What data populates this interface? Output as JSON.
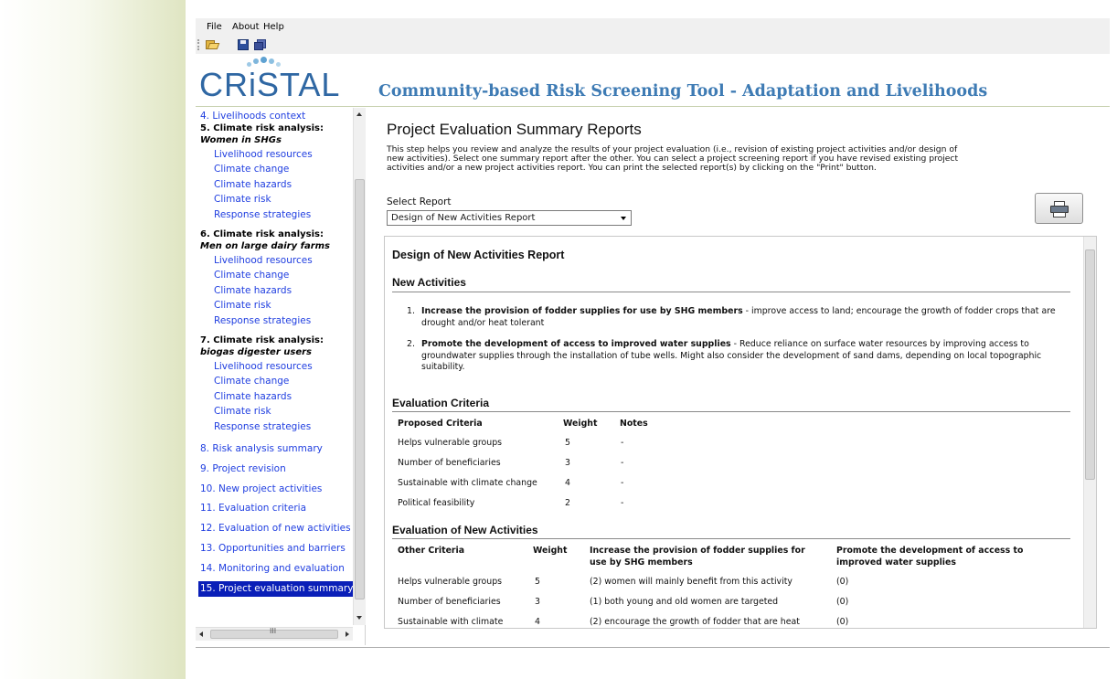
{
  "menu": {
    "items": [
      "File",
      "About",
      "Help"
    ]
  },
  "toolbar": {
    "open_icon": "open-folder-icon",
    "save_icon": "save-icon",
    "save_all_icon": "save-all-icon"
  },
  "logo": {
    "text": "CRiSTAL"
  },
  "app_title": "Community-based Risk Screening Tool - Adaptation and Livelihoods",
  "colors": {
    "nav_link": "#1f3ee0",
    "nav_active_bg": "#0a1fb8",
    "title": "#3e7bb4",
    "logo": "#2f67a3"
  },
  "sidebar": {
    "items": [
      {
        "kind": "link",
        "label": "4. Livelihoods context"
      },
      {
        "kind": "heading",
        "label": "5. Climate risk analysis:",
        "sub": "Women in SHGs"
      },
      {
        "kind": "sub",
        "label": "Livelihood resources"
      },
      {
        "kind": "sub",
        "label": "Climate change"
      },
      {
        "kind": "sub",
        "label": "Climate hazards"
      },
      {
        "kind": "sub",
        "label": "Climate risk"
      },
      {
        "kind": "sub",
        "label": "Response strategies"
      },
      {
        "kind": "heading",
        "label": "6. Climate risk analysis:",
        "sub": "Men on large dairy farms"
      },
      {
        "kind": "sub",
        "label": "Livelihood resources"
      },
      {
        "kind": "sub",
        "label": "Climate change"
      },
      {
        "kind": "sub",
        "label": "Climate hazards"
      },
      {
        "kind": "sub",
        "label": "Climate risk"
      },
      {
        "kind": "sub",
        "label": "Response strategies"
      },
      {
        "kind": "heading",
        "label": "7. Climate risk analysis:",
        "sub": "biogas digester users"
      },
      {
        "kind": "sub",
        "label": "Livelihood resources"
      },
      {
        "kind": "sub",
        "label": "Climate change"
      },
      {
        "kind": "sub",
        "label": "Climate hazards"
      },
      {
        "kind": "sub",
        "label": "Climate risk"
      },
      {
        "kind": "sub",
        "label": "Response strategies"
      },
      {
        "kind": "link",
        "label": "8. Risk analysis summary"
      },
      {
        "kind": "link",
        "label": "9. Project revision"
      },
      {
        "kind": "link",
        "label": "10. New project activities"
      },
      {
        "kind": "link",
        "label": "11. Evaluation criteria"
      },
      {
        "kind": "link",
        "label": "12. Evaluation of new activities"
      },
      {
        "kind": "link",
        "label": "13. Opportunities and barriers"
      },
      {
        "kind": "link",
        "label": "14. Monitoring and evaluation"
      },
      {
        "kind": "active",
        "label": "15. Project evaluation summary"
      }
    ],
    "hscroll_glyph": "III"
  },
  "main": {
    "title": "Project Evaluation Summary Reports",
    "intro": "This step helps you review and analyze the results of your project evaluation (i.e., revision of existing project activities and/or design of new activities). Select one summary report after the other. You can select a project screening report if you have revised existing project activities and/or a new project activities report. You can print the selected report(s) by clicking on the \"Print\" button.",
    "select_label": "Select Report",
    "select_value": "Design of New Activities Report",
    "print_icon": "printer-icon"
  },
  "report": {
    "title": "Design of New Activities Report",
    "new_activities": {
      "heading": "New Activities",
      "items": [
        {
          "num": "1.",
          "bold": "Increase the provision of fodder supplies for use by SHG members",
          "text": " - improve access to land; encourage the growth of fodder crops that are drought and/or heat tolerant"
        },
        {
          "num": "2.",
          "bold": "Promote the development of access to improved water supplies",
          "text": " - Reduce reliance on surface water resources by improving access to groundwater supplies through the installation of tube wells. Might also consider the development of sand dams, depending on local topographic suitability."
        }
      ]
    },
    "evaluation_criteria": {
      "heading": "Evaluation Criteria",
      "headers": [
        "Proposed Criteria",
        "Weight",
        "Notes"
      ],
      "rows": [
        [
          "Helps vulnerable groups",
          "5",
          "-"
        ],
        [
          "Number of beneficiaries",
          "3",
          "-"
        ],
        [
          "Sustainable with climate change",
          "4",
          "-"
        ],
        [
          "Political feasibility",
          "2",
          "-"
        ]
      ]
    },
    "evaluation_new": {
      "heading": "Evaluation of New Activities",
      "headers": [
        "Other Criteria",
        "Weight",
        "Increase the provision of fodder supplies for",
        "use by SHG members",
        "Promote the development of access to",
        "improved water supplies"
      ],
      "rows": [
        [
          "Helps vulnerable groups",
          "5",
          "(2) women will mainly benefit from this activity",
          "(0)"
        ],
        [
          "Number of beneficiaries",
          "3",
          "(1) both young and old women are targeted",
          "(0)"
        ],
        [
          "Sustainable with climate",
          "4",
          "(2) encourage the growth of fodder that are heat",
          "(0)"
        ]
      ]
    }
  }
}
